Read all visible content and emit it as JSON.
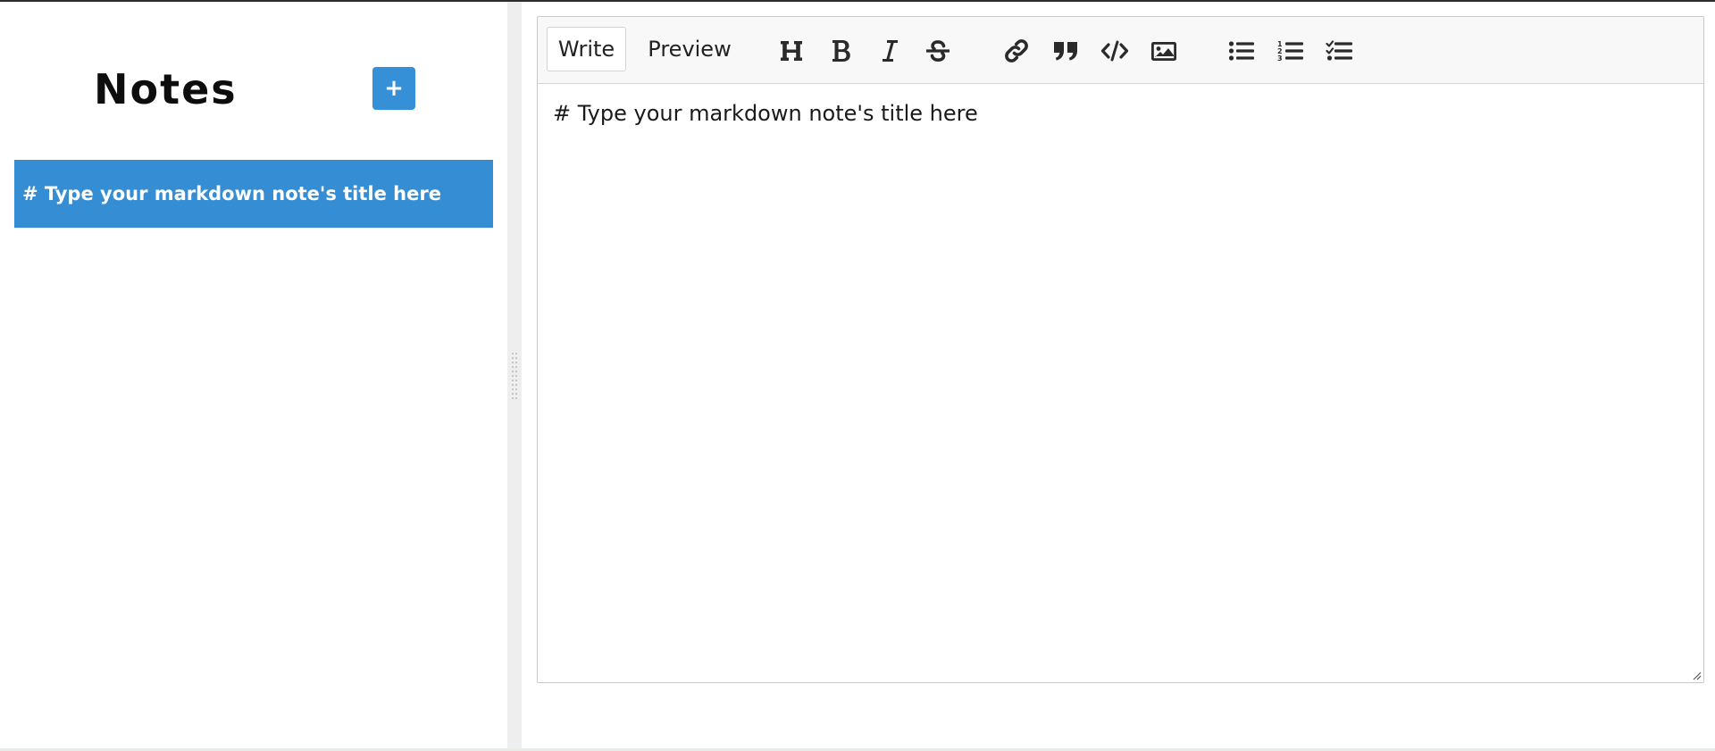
{
  "sidebar": {
    "title": "Notes",
    "add_button_label": "+",
    "notes": [
      {
        "title": "# Type your markdown note's title here",
        "selected": true
      }
    ]
  },
  "editor": {
    "tabs": [
      {
        "label": "Write",
        "active": true
      },
      {
        "label": "Preview",
        "active": false
      }
    ],
    "toolbar": [
      {
        "name": "header",
        "icon": "header-icon"
      },
      {
        "name": "bold",
        "icon": "bold-icon"
      },
      {
        "name": "italic",
        "icon": "italic-icon"
      },
      {
        "name": "strikethrough",
        "icon": "strikethrough-icon"
      },
      {
        "name": "link",
        "icon": "link-icon"
      },
      {
        "name": "quote",
        "icon": "quote-icon"
      },
      {
        "name": "code",
        "icon": "code-icon"
      },
      {
        "name": "image",
        "icon": "image-icon"
      },
      {
        "name": "unordered-list",
        "icon": "unordered-list-icon"
      },
      {
        "name": "ordered-list",
        "icon": "ordered-list-icon"
      },
      {
        "name": "checked-list",
        "icon": "checked-list-icon"
      }
    ],
    "content": "# Type your markdown note's title here"
  },
  "colors": {
    "accent": "#358ed4",
    "add_button": "#3590d7",
    "toolbar_bg": "#f8f8f8",
    "splitter": "#eeeeee"
  }
}
